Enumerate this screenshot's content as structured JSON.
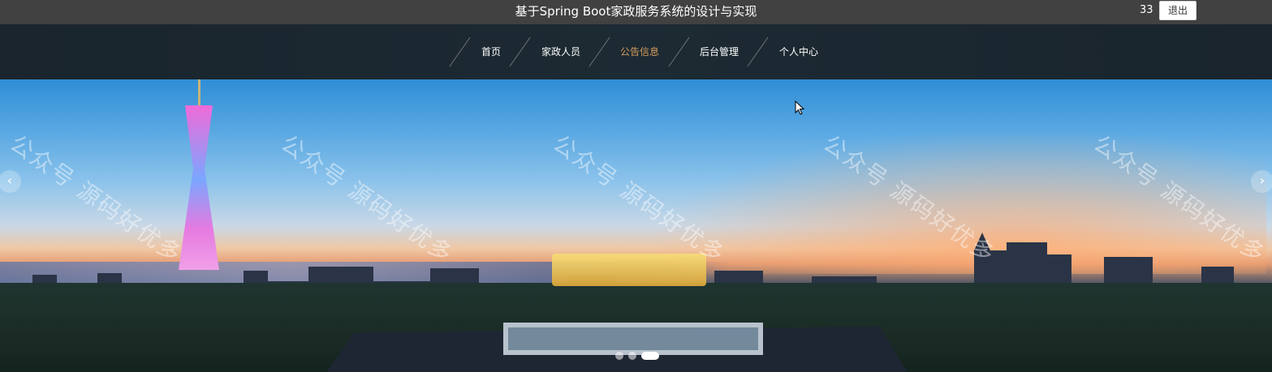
{
  "header": {
    "title": "基于Spring Boot家政服务系统的设计与实现",
    "username": "33",
    "logout_label": "退出"
  },
  "nav": {
    "items": [
      {
        "label": "首页"
      },
      {
        "label": "家政人员"
      },
      {
        "label": "公告信息",
        "active": true
      },
      {
        "label": "后台管理"
      },
      {
        "label": "个人中心"
      }
    ]
  },
  "banner": {
    "watermark_text": "公众号 源码好优多",
    "prev_arrow": "‹",
    "next_arrow": "›",
    "slide_count": 3,
    "active_slide": 3
  },
  "colors": {
    "topbar": "#414141",
    "navbar": "#1c2a33",
    "nav_active": "#d49b5c"
  },
  "icons": [
    "chevron-left-icon",
    "chevron-right-icon",
    "mouse-cursor-icon"
  ]
}
